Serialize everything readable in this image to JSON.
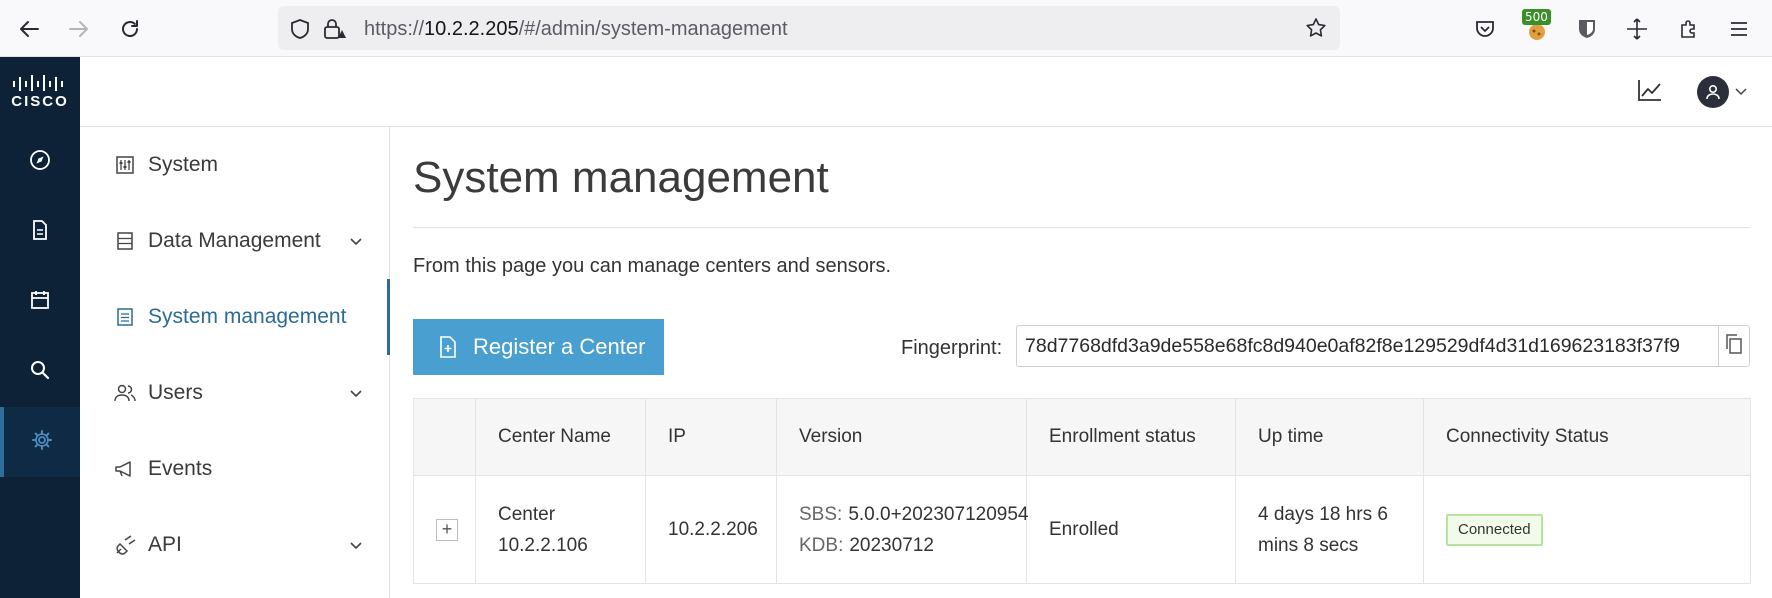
{
  "browser": {
    "url_prefix": "https://",
    "url_host": "10.2.2.205",
    "url_path": "/#/admin/system-management",
    "badge": "500"
  },
  "rail": {
    "logo_text": "CISCO",
    "items": [
      {
        "icon": "compass-icon"
      },
      {
        "icon": "document-icon"
      },
      {
        "icon": "calendar-icon"
      },
      {
        "icon": "search-icon"
      },
      {
        "icon": "gear-icon",
        "active": true
      }
    ]
  },
  "subnav": {
    "items": [
      {
        "label": "System",
        "icon": "sliders-icon",
        "chevron": false
      },
      {
        "label": "Data Management",
        "icon": "database-icon",
        "chevron": true
      },
      {
        "label": "System management",
        "icon": "clipboard-icon",
        "chevron": false,
        "active": true
      },
      {
        "label": "Users",
        "icon": "users-icon",
        "chevron": true
      },
      {
        "label": "Events",
        "icon": "megaphone-icon",
        "chevron": false
      },
      {
        "label": "API",
        "icon": "plug-icon",
        "chevron": true
      }
    ]
  },
  "main": {
    "title": "System management",
    "description": "From this page you can manage centers and sensors.",
    "register_button": "Register a Center",
    "fingerprint_label": "Fingerprint:",
    "fingerprint_value": "78d7768dfd3a9de558e68fc8d940e0af82f8e129529df4d31d169623183f37f9"
  },
  "table": {
    "headers": [
      "",
      "Center Name",
      "IP",
      "Version",
      "Enrollment status",
      "Up time",
      "Connectivity Status"
    ],
    "rows": [
      {
        "expand": "+",
        "center_name": "Center 10.2.2.106",
        "ip": "10.2.2.206",
        "sbs_key": "SBS:",
        "sbs_value": "5.0.0+202307120954",
        "kdb_key": "KDB:",
        "kdb_value": "20230712",
        "enrollment": "Enrolled",
        "uptime": "4 days 18 hrs 6 mins 8 secs",
        "connectivity": "Connected"
      }
    ]
  },
  "colors": {
    "rail_bg": "#0d2237",
    "accent": "#2c6b96",
    "button_bg": "#4a9fd1",
    "connected_border": "#b5e6a0"
  }
}
